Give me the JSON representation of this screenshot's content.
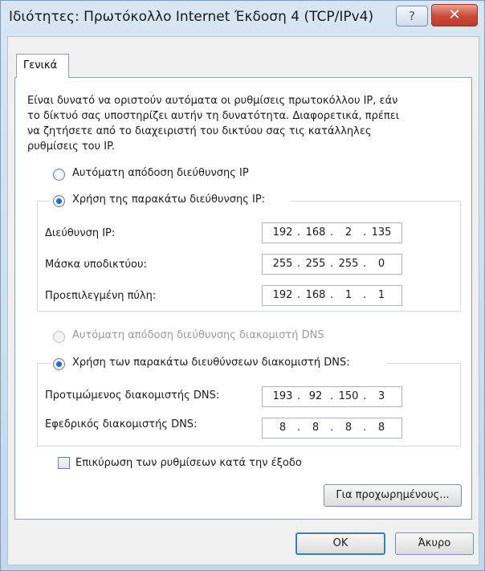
{
  "window": {
    "title": "Ιδιότητες: Πρωτόκολλο Internet Έκδοση 4 (TCP/IPv4)",
    "help_glyph": "?",
    "close_glyph": "✕"
  },
  "tabs": [
    {
      "label": "Γενικά"
    }
  ],
  "description": [
    "Είναι δυνατό να οριστούν αυτόματα οι ρυθμίσεις πρωτοκόλλου IP, εάν",
    "το δίκτυό σας υποστηρίζει αυτήν τη δυνατότητα. Διαφορετικά, πρέπει",
    "να ζητήσετε από το διαχειριστή του δικτύου σας τις κατάλληλες",
    "ρυθμίσεις του IP."
  ],
  "ip": {
    "auto_label": "Αυτόματη απόδοση διεύθυνσης IP",
    "manual_label": "Χρήση της παρακάτω διεύθυνσης IP:",
    "selected": "manual",
    "fields": [
      {
        "label": "Διεύθυνση IP:",
        "octets": [
          "192",
          "168",
          "2",
          "135"
        ]
      },
      {
        "label": "Μάσκα υποδικτύου:",
        "octets": [
          "255",
          "255",
          "255",
          "0"
        ]
      },
      {
        "label": "Προεπιλεγμένη πύλη:",
        "octets": [
          "192",
          "168",
          "1",
          "1"
        ]
      }
    ]
  },
  "dns": {
    "auto_label": "Αυτόματη απόδοση διεύθυνσης διακομιστή DNS",
    "manual_label": "Χρήση των παρακάτω διευθύνσεων διακομιστή DNS:",
    "selected": "manual",
    "fields": [
      {
        "label": "Προτιμώμενος διακομιστής DNS:",
        "octets": [
          "193",
          "92",
          "150",
          "3"
        ]
      },
      {
        "label": "Εφεδρικός διακομιστής DNS:",
        "octets": [
          "8",
          "8",
          "8",
          "8"
        ]
      }
    ]
  },
  "validate_label": "Επικύρωση των ρυθμίσεων κατά την έξοδο",
  "validate_checked": false,
  "advanced_label": "Για προχωρημένους...",
  "ok_label": "OK",
  "cancel_label": "Άκυρο",
  "accent_color": "#2a68c8"
}
